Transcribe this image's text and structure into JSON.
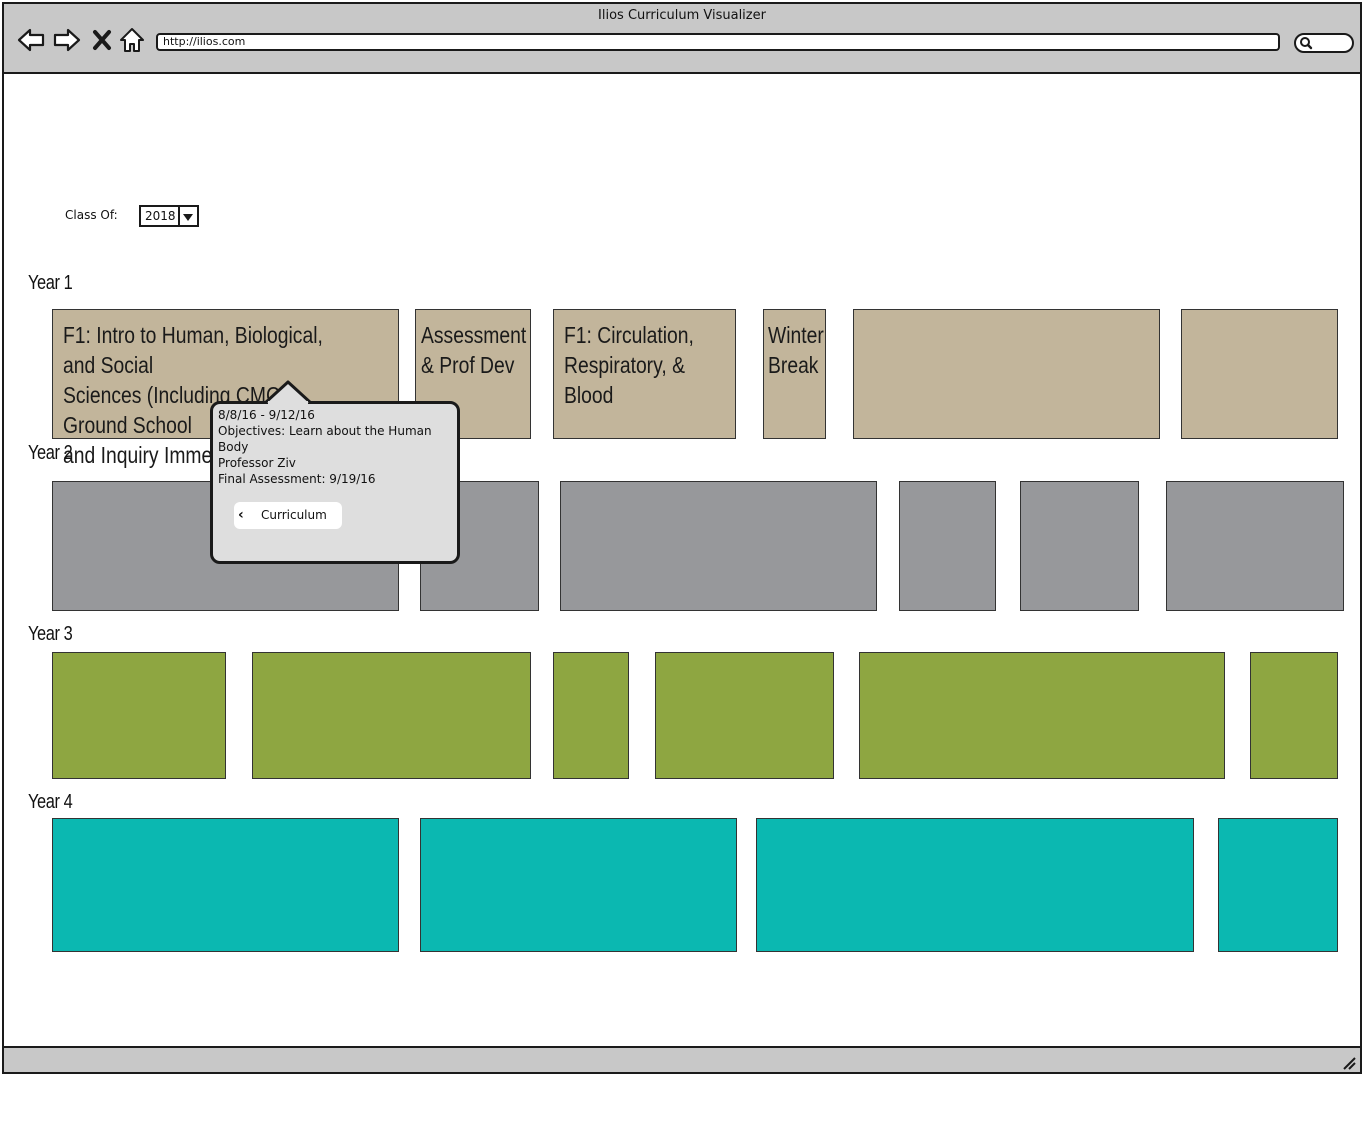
{
  "browser": {
    "title": "Ilios Curriculum Visualizer",
    "url": "http://ilios.com"
  },
  "filter": {
    "label": "Class Of:",
    "selected": "2018"
  },
  "years": [
    {
      "label": "Year 1",
      "color": "#c2b59b",
      "blocks": [
        "F1: Intro to Human, Biological, and Social\nSciences (Including CMC Ground School\nand Inquiry Immersion)",
        "Assessment\n& Prof Dev",
        "F1: Circulation,\nRespiratory, & Blood",
        "Winter\nBreak",
        "",
        ""
      ]
    },
    {
      "label": "Year 2",
      "color": "#97989b"
    },
    {
      "label": "Year 3",
      "color": "#8ea641"
    },
    {
      "label": "Year 4",
      "color": "#0bb8b1"
    }
  ],
  "popover": {
    "dates": "8/8/16 - 9/12/16",
    "objectives": "Objectives: Learn about the Human\nBody",
    "professor": "Professor Ziv",
    "assessment": "Final Assessment: 9/19/16",
    "back_button": "Curriculum"
  }
}
